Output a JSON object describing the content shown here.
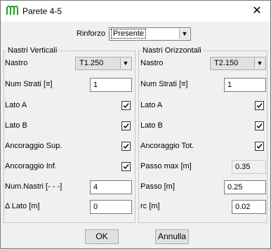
{
  "window": {
    "title": "Parete 4-5",
    "close": "✕"
  },
  "header": {
    "rinforzo_label": "Rinforzo",
    "rinforzo_value": "Presente"
  },
  "left": {
    "group_title": "Nastri Verticali",
    "nastro_label": "Nastro",
    "nastro_value": "T1.250",
    "num_strati_label": "Num Strati [≡]",
    "num_strati_value": "1",
    "lato_a_label": "Lato A",
    "lato_a_checked": true,
    "lato_b_label": "Lato B",
    "lato_b_checked": true,
    "anc_sup_label": "Ancoraggio Sup.",
    "anc_sup_checked": true,
    "anc_inf_label": "Ancoraggio Inf.",
    "anc_inf_checked": true,
    "num_nastri_label": "Num.Nastri [- - -]",
    "num_nastri_value": "4",
    "delta_lato_label": "Δ Lato [m]",
    "delta_lato_value": "0"
  },
  "right": {
    "group_title": "Nastri Orizzontali",
    "nastro_label": "Nastro",
    "nastro_value": "T2.150",
    "num_strati_label": "Num Strati [≡]",
    "num_strati_value": "1",
    "lato_a_label": "Lato A",
    "lato_a_checked": true,
    "lato_b_label": "Lato B",
    "lato_b_checked": true,
    "anc_tot_label": "Ancoraggio Tot.",
    "anc_tot_checked": true,
    "passo_max_label": "Passo max [m]",
    "passo_max_value": "0.35",
    "passo_label": "Passo [m]",
    "passo_value": "0.25",
    "rc_label": "rc [m]",
    "rc_value": "0.02"
  },
  "footer": {
    "ok_label": "OK",
    "cancel_label": "Annulla"
  },
  "colors": {
    "accent": "#1fa02a"
  }
}
